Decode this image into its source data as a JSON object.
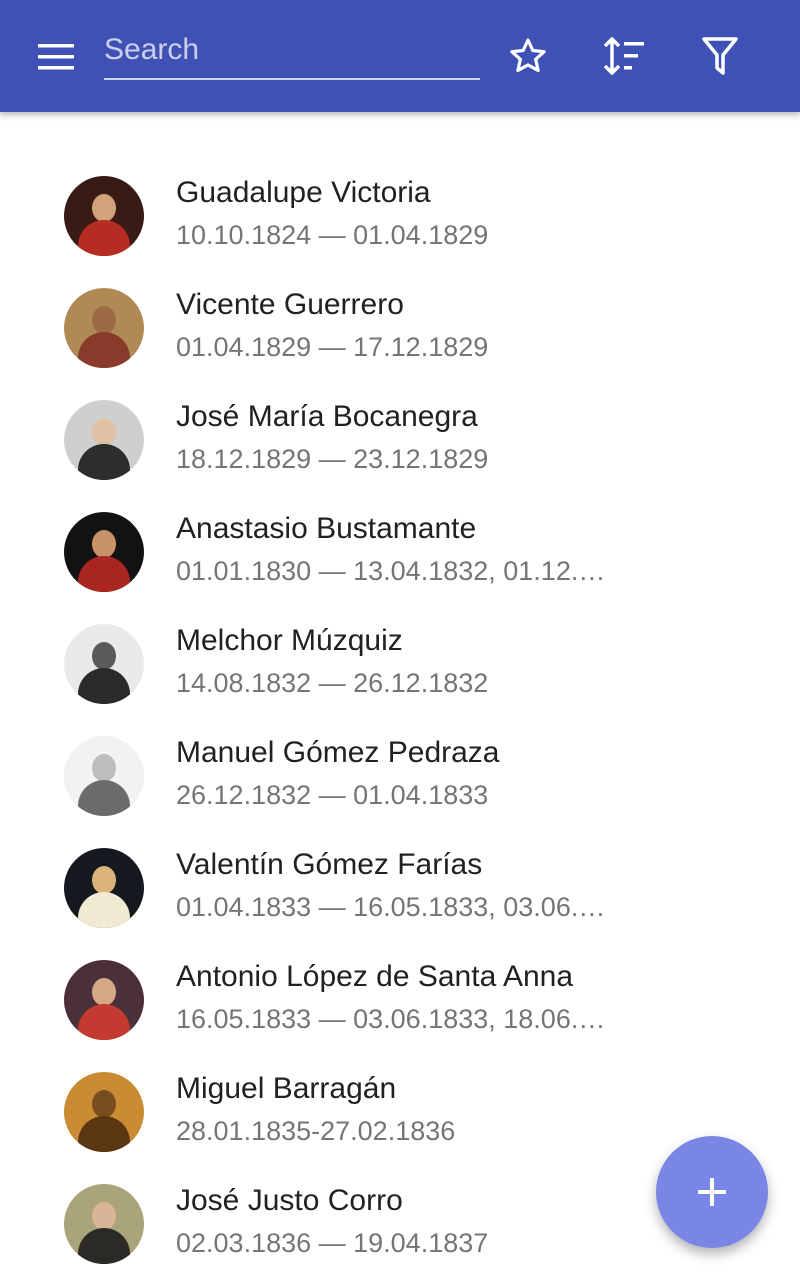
{
  "search": {
    "placeholder": "Search",
    "value": ""
  },
  "icons": {
    "menu": "menu-icon",
    "favorites": "star-outline-icon",
    "sort": "sort-icon",
    "filter": "filter-icon",
    "add": "plus-icon"
  },
  "colors": {
    "app_bar": "#3f51b5",
    "fab": "#7986e6",
    "primary_text": "#212121",
    "secondary_text": "#757575"
  },
  "presidents": [
    {
      "name": "Guadalupe Victoria",
      "dates": "10.10.1824 — 01.04.1829"
    },
    {
      "name": "Vicente Guerrero",
      "dates": "01.04.1829 — 17.12.1829"
    },
    {
      "name": "José María Bocanegra",
      "dates": "18.12.1829 — 23.12.1829"
    },
    {
      "name": "Anastasio Bustamante",
      "dates": "01.01.1830 — 13.04.1832, 01.12.1…"
    },
    {
      "name": "Melchor Múzquiz",
      "dates": "14.08.1832 — 26.12.1832"
    },
    {
      "name": "Manuel Gómez Pedraza",
      "dates": "26.12.1832 — 01.04.1833"
    },
    {
      "name": "Valentín Gómez Farías",
      "dates": "01.04.1833 — 16.05.1833, 03.06.1…"
    },
    {
      "name": "Antonio López de Santa Anna",
      "dates": "16.05.1833 — 03.06.1833, 18.06.1…"
    },
    {
      "name": "Miguel Barragán",
      "dates": "28.01.1835-27.02.1836"
    },
    {
      "name": "José Justo Corro",
      "dates": "02.03.1836 — 19.04.1837"
    }
  ]
}
